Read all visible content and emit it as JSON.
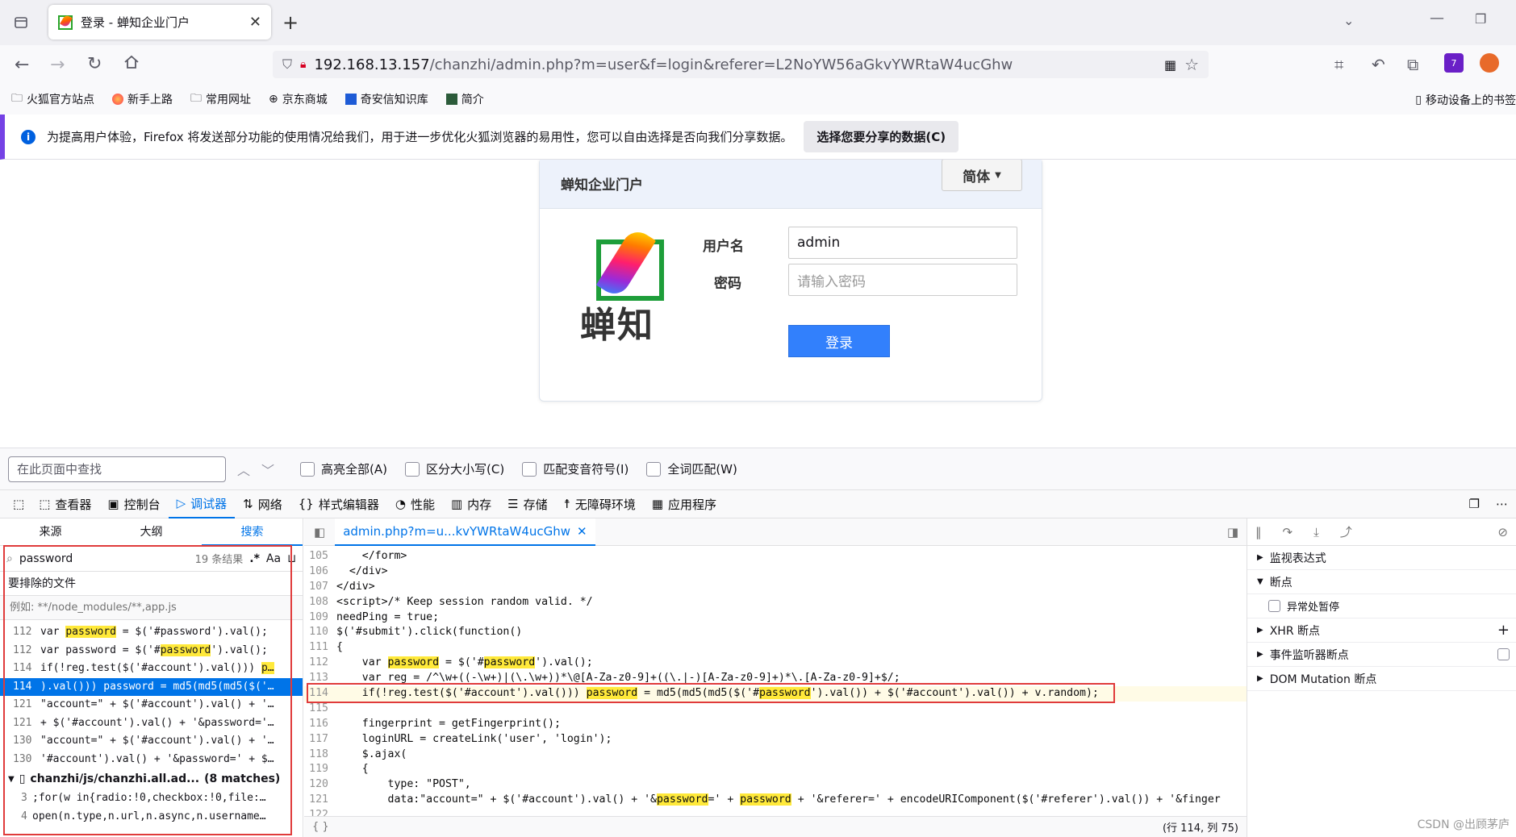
{
  "browser": {
    "tab_title": "登录 - 蝉知企业门户",
    "url_host": "192.168.13.157",
    "url_path": "/chanzhi/admin.php?m=user&f=login&referer=L2NoYW56aGkvYWRtaW4ucGhw",
    "bookmarks": [
      "火狐官方站点",
      "新手上路",
      "常用网址",
      "京东商城",
      "奇安信知识库",
      "简介"
    ],
    "mobile_bookmarks": "移动设备上的书签",
    "notice_text": "为提高用户体验，Firefox 将发送部分功能的使用情况给我们，用于进一步优化火狐浏览器的易用性，您可以自由选择是否向我们分享数据。",
    "notice_button": "选择您要分享的数据(C)",
    "accent": "#7542e5"
  },
  "login": {
    "header": "蝉知企业门户",
    "lang_button": "简体",
    "logo_text": "蝉知",
    "username_label": "用户名",
    "username_value": "admin",
    "password_label": "密码",
    "password_placeholder": "请输入密码",
    "submit_label": "登录",
    "submit_color": "#3280fc"
  },
  "findbar": {
    "placeholder": "在此页面中查找",
    "options": [
      "高亮全部(A)",
      "区分大小写(C)",
      "匹配变音符号(I)",
      "全词匹配(W)"
    ]
  },
  "devtools": {
    "tabs": [
      "查看器",
      "控制台",
      "调试器",
      "网络",
      "样式编辑器",
      "性能",
      "内存",
      "存储",
      "无障碍环境",
      "应用程序"
    ],
    "selected_tab": "调试器",
    "left_tabs": [
      "来源",
      "大纲",
      "搜索"
    ],
    "search_query": "password",
    "search_count": "19 条结果",
    "exclude_label": "要排除的文件",
    "exclude_placeholder": "例如: **/node_modules/**,app.js",
    "results": [
      {
        "ln": "112",
        "pre": "var ",
        "hit": "password",
        "post": " = $('#password').val();"
      },
      {
        "ln": "112",
        "pre": "var password = $('#",
        "hit": "password",
        "post": "').val();"
      },
      {
        "ln": "114",
        "pre": "if(!reg.test($('#account').val())) ",
        "hit": "p…",
        "post": ""
      },
      {
        "ln": "114",
        "pre": ").val())) password = md5(md5(md5($('…",
        "hit": "",
        "post": "",
        "selected": true
      },
      {
        "ln": "121",
        "pre": "\"account=\" + $('#account').val() + '…",
        "hit": "",
        "post": ""
      },
      {
        "ln": "121",
        "pre": "+ $('#account').val() + '&password='…",
        "hit": "",
        "post": ""
      },
      {
        "ln": "130",
        "pre": "\"account=\" + $('#account').val() + '…",
        "hit": "",
        "post": ""
      },
      {
        "ln": "130",
        "pre": "'#account').val() + '&password=' + $…",
        "hit": "",
        "post": ""
      }
    ],
    "file_group": "chanzhi/js/chanzhi.all.ad...",
    "file_group_count": "(8 matches)",
    "file_results": [
      {
        "ln": "3",
        "text": ";for(w in{radio:!0,checkbox:!0,file:…"
      },
      {
        "ln": "4",
        "text": "open(n.type,n.url,n.async,n.username…"
      }
    ],
    "editor_tab": "admin.php?m=u...kvYWRtaW4ucGhw",
    "status": "(行 114, 列 75)",
    "code": [
      {
        "n": "105",
        "t": "    </form>"
      },
      {
        "n": "106",
        "t": "  </div>"
      },
      {
        "n": "107",
        "t": "</div>"
      },
      {
        "n": "108",
        "t": "<script>/* Keep session random valid. */"
      },
      {
        "n": "109",
        "t": "needPing = true;"
      },
      {
        "n": "110",
        "t": "$('#submit').click(function()"
      },
      {
        "n": "111",
        "t": "{"
      },
      {
        "n": "112",
        "t": "    var password = $('#password').val();"
      },
      {
        "n": "113",
        "t": "    var reg = /^\\w+((-\\w+)|(\\.\\w+))*\\@[A-Za-z0-9]+((\\.|-)[A-Za-z0-9]+)*\\.[A-Za-z0-9]+$/;"
      },
      {
        "n": "114",
        "t": "    if(!reg.test($('#account').val())) password = md5(md5(md5($('#password').val()) + $('#account').val()) + v.random);"
      },
      {
        "n": "115",
        "t": ""
      },
      {
        "n": "116",
        "t": "    fingerprint = getFingerprint();"
      },
      {
        "n": "117",
        "t": "    loginURL = createLink('user', 'login');"
      },
      {
        "n": "118",
        "t": "    $.ajax("
      },
      {
        "n": "119",
        "t": "    {"
      },
      {
        "n": "120",
        "t": "        type: \"POST\","
      },
      {
        "n": "121",
        "t": "        data:\"account=\" + $('#account').val() + '&password=' + password + '&referer=' + encodeURIComponent($('#referer').val()) + '&finger"
      },
      {
        "n": "122",
        "t": ""
      }
    ],
    "right_panel": [
      "监视表达式",
      "断点",
      "异常处暂停",
      "XHR 断点",
      "事件监听器断点",
      "DOM Mutation 断点"
    ]
  },
  "watermark": "CSDN @出顾茅庐"
}
